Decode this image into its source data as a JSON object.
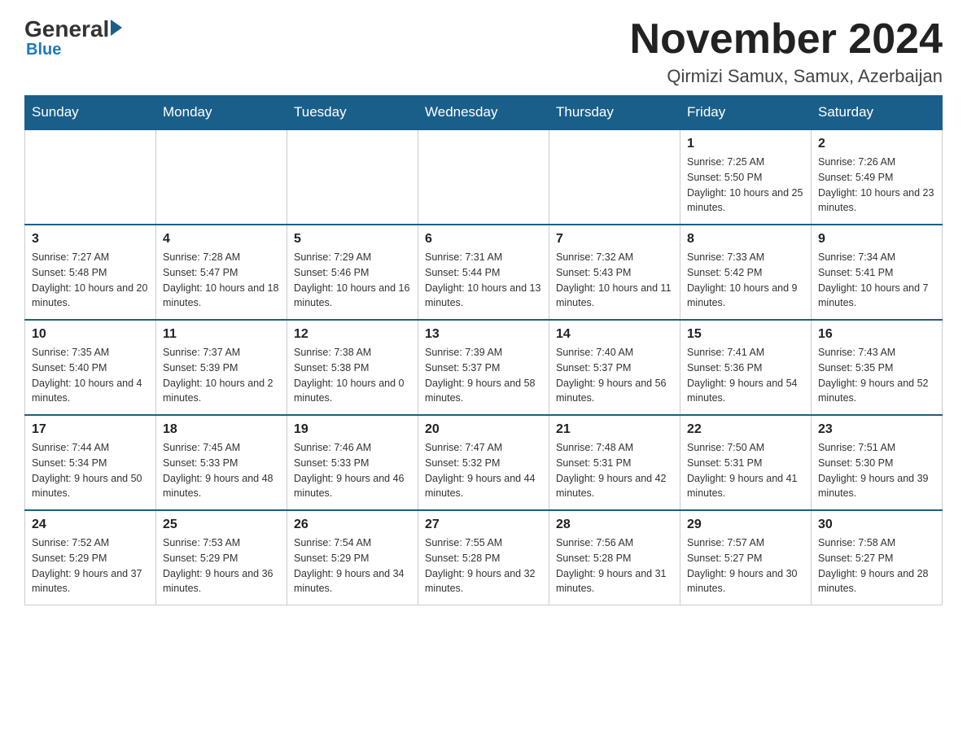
{
  "logo": {
    "general": "General",
    "blue": "Blue",
    "subtext": "Blue"
  },
  "header": {
    "month_title": "November 2024",
    "location": "Qirmizi Samux, Samux, Azerbaijan"
  },
  "weekdays": [
    "Sunday",
    "Monday",
    "Tuesday",
    "Wednesday",
    "Thursday",
    "Friday",
    "Saturday"
  ],
  "weeks": [
    [
      {
        "day": "",
        "sunrise": "",
        "sunset": "",
        "daylight": ""
      },
      {
        "day": "",
        "sunrise": "",
        "sunset": "",
        "daylight": ""
      },
      {
        "day": "",
        "sunrise": "",
        "sunset": "",
        "daylight": ""
      },
      {
        "day": "",
        "sunrise": "",
        "sunset": "",
        "daylight": ""
      },
      {
        "day": "",
        "sunrise": "",
        "sunset": "",
        "daylight": ""
      },
      {
        "day": "1",
        "sunrise": "Sunrise: 7:25 AM",
        "sunset": "Sunset: 5:50 PM",
        "daylight": "Daylight: 10 hours and 25 minutes."
      },
      {
        "day": "2",
        "sunrise": "Sunrise: 7:26 AM",
        "sunset": "Sunset: 5:49 PM",
        "daylight": "Daylight: 10 hours and 23 minutes."
      }
    ],
    [
      {
        "day": "3",
        "sunrise": "Sunrise: 7:27 AM",
        "sunset": "Sunset: 5:48 PM",
        "daylight": "Daylight: 10 hours and 20 minutes."
      },
      {
        "day": "4",
        "sunrise": "Sunrise: 7:28 AM",
        "sunset": "Sunset: 5:47 PM",
        "daylight": "Daylight: 10 hours and 18 minutes."
      },
      {
        "day": "5",
        "sunrise": "Sunrise: 7:29 AM",
        "sunset": "Sunset: 5:46 PM",
        "daylight": "Daylight: 10 hours and 16 minutes."
      },
      {
        "day": "6",
        "sunrise": "Sunrise: 7:31 AM",
        "sunset": "Sunset: 5:44 PM",
        "daylight": "Daylight: 10 hours and 13 minutes."
      },
      {
        "day": "7",
        "sunrise": "Sunrise: 7:32 AM",
        "sunset": "Sunset: 5:43 PM",
        "daylight": "Daylight: 10 hours and 11 minutes."
      },
      {
        "day": "8",
        "sunrise": "Sunrise: 7:33 AM",
        "sunset": "Sunset: 5:42 PM",
        "daylight": "Daylight: 10 hours and 9 minutes."
      },
      {
        "day": "9",
        "sunrise": "Sunrise: 7:34 AM",
        "sunset": "Sunset: 5:41 PM",
        "daylight": "Daylight: 10 hours and 7 minutes."
      }
    ],
    [
      {
        "day": "10",
        "sunrise": "Sunrise: 7:35 AM",
        "sunset": "Sunset: 5:40 PM",
        "daylight": "Daylight: 10 hours and 4 minutes."
      },
      {
        "day": "11",
        "sunrise": "Sunrise: 7:37 AM",
        "sunset": "Sunset: 5:39 PM",
        "daylight": "Daylight: 10 hours and 2 minutes."
      },
      {
        "day": "12",
        "sunrise": "Sunrise: 7:38 AM",
        "sunset": "Sunset: 5:38 PM",
        "daylight": "Daylight: 10 hours and 0 minutes."
      },
      {
        "day": "13",
        "sunrise": "Sunrise: 7:39 AM",
        "sunset": "Sunset: 5:37 PM",
        "daylight": "Daylight: 9 hours and 58 minutes."
      },
      {
        "day": "14",
        "sunrise": "Sunrise: 7:40 AM",
        "sunset": "Sunset: 5:37 PM",
        "daylight": "Daylight: 9 hours and 56 minutes."
      },
      {
        "day": "15",
        "sunrise": "Sunrise: 7:41 AM",
        "sunset": "Sunset: 5:36 PM",
        "daylight": "Daylight: 9 hours and 54 minutes."
      },
      {
        "day": "16",
        "sunrise": "Sunrise: 7:43 AM",
        "sunset": "Sunset: 5:35 PM",
        "daylight": "Daylight: 9 hours and 52 minutes."
      }
    ],
    [
      {
        "day": "17",
        "sunrise": "Sunrise: 7:44 AM",
        "sunset": "Sunset: 5:34 PM",
        "daylight": "Daylight: 9 hours and 50 minutes."
      },
      {
        "day": "18",
        "sunrise": "Sunrise: 7:45 AM",
        "sunset": "Sunset: 5:33 PM",
        "daylight": "Daylight: 9 hours and 48 minutes."
      },
      {
        "day": "19",
        "sunrise": "Sunrise: 7:46 AM",
        "sunset": "Sunset: 5:33 PM",
        "daylight": "Daylight: 9 hours and 46 minutes."
      },
      {
        "day": "20",
        "sunrise": "Sunrise: 7:47 AM",
        "sunset": "Sunset: 5:32 PM",
        "daylight": "Daylight: 9 hours and 44 minutes."
      },
      {
        "day": "21",
        "sunrise": "Sunrise: 7:48 AM",
        "sunset": "Sunset: 5:31 PM",
        "daylight": "Daylight: 9 hours and 42 minutes."
      },
      {
        "day": "22",
        "sunrise": "Sunrise: 7:50 AM",
        "sunset": "Sunset: 5:31 PM",
        "daylight": "Daylight: 9 hours and 41 minutes."
      },
      {
        "day": "23",
        "sunrise": "Sunrise: 7:51 AM",
        "sunset": "Sunset: 5:30 PM",
        "daylight": "Daylight: 9 hours and 39 minutes."
      }
    ],
    [
      {
        "day": "24",
        "sunrise": "Sunrise: 7:52 AM",
        "sunset": "Sunset: 5:29 PM",
        "daylight": "Daylight: 9 hours and 37 minutes."
      },
      {
        "day": "25",
        "sunrise": "Sunrise: 7:53 AM",
        "sunset": "Sunset: 5:29 PM",
        "daylight": "Daylight: 9 hours and 36 minutes."
      },
      {
        "day": "26",
        "sunrise": "Sunrise: 7:54 AM",
        "sunset": "Sunset: 5:29 PM",
        "daylight": "Daylight: 9 hours and 34 minutes."
      },
      {
        "day": "27",
        "sunrise": "Sunrise: 7:55 AM",
        "sunset": "Sunset: 5:28 PM",
        "daylight": "Daylight: 9 hours and 32 minutes."
      },
      {
        "day": "28",
        "sunrise": "Sunrise: 7:56 AM",
        "sunset": "Sunset: 5:28 PM",
        "daylight": "Daylight: 9 hours and 31 minutes."
      },
      {
        "day": "29",
        "sunrise": "Sunrise: 7:57 AM",
        "sunset": "Sunset: 5:27 PM",
        "daylight": "Daylight: 9 hours and 30 minutes."
      },
      {
        "day": "30",
        "sunrise": "Sunrise: 7:58 AM",
        "sunset": "Sunset: 5:27 PM",
        "daylight": "Daylight: 9 hours and 28 minutes."
      }
    ]
  ]
}
